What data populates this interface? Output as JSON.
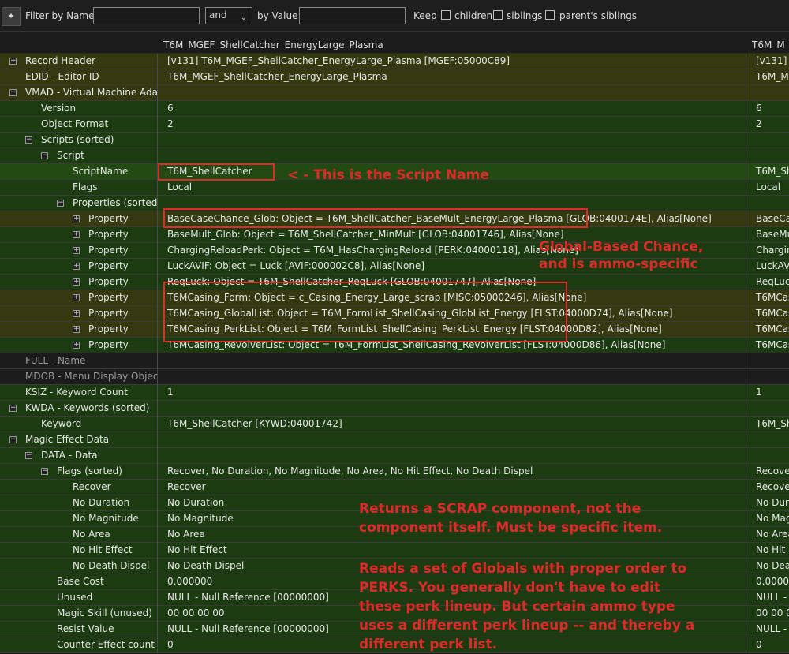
{
  "filter": {
    "pin_icon": "pin-icon",
    "name_label": "Filter by Name:",
    "name_value": "",
    "op_value": "and",
    "value_label": "by Value:",
    "value_value": "",
    "keep_label": "Keep",
    "checkboxes": [
      {
        "label": "children",
        "checked": false
      },
      {
        "label": "siblings",
        "checked": false
      },
      {
        "label": "parent's siblings",
        "checked": false
      }
    ]
  },
  "columns": {
    "col1": "T6M_MGEF_ShellCatcher_EnergyLarge_Plasma",
    "col2": "T6M_M"
  },
  "rows": [
    {
      "name": "Record Header",
      "level": 0,
      "expander": "+",
      "v1": "[v131] T6M_MGEF_ShellCatcher_EnergyLarge_Plasma [MGEF:05000C89]",
      "v2": "[v131] T",
      "bg": "bgO"
    },
    {
      "name": "EDID - Editor ID",
      "level": 0,
      "expander": "",
      "v1": "T6M_MGEF_ShellCatcher_EnergyLarge_Plasma",
      "v2": "T6M_MG",
      "bg": "bgO"
    },
    {
      "name": "VMAD - Virtual Machine Ada...",
      "level": 0,
      "expander": "-",
      "v1": "",
      "v2": "",
      "bg": "bgO"
    },
    {
      "name": "Version",
      "level": 1,
      "expander": "",
      "v1": "6",
      "v2": "6",
      "bg": "bgG"
    },
    {
      "name": "Object Format",
      "level": 1,
      "expander": "",
      "v1": "2",
      "v2": "2",
      "bg": "bgG"
    },
    {
      "name": "Scripts (sorted)",
      "level": 1,
      "expander": "-",
      "v1": "",
      "v2": "",
      "bg": "bgG"
    },
    {
      "name": "Script",
      "level": 2,
      "expander": "-",
      "v1": "",
      "v2": "",
      "bg": "bgG"
    },
    {
      "name": "ScriptName",
      "level": 3,
      "expander": "",
      "v1": "T6M_ShellCatcher",
      "v2": "T6M_Sh",
      "bg": "bgS"
    },
    {
      "name": "Flags",
      "level": 3,
      "expander": "",
      "v1": "Local",
      "v2": "Local",
      "bg": "bgG"
    },
    {
      "name": "Properties (sorted)",
      "level": 3,
      "expander": "-",
      "v1": "",
      "v2": "",
      "bg": "bgG"
    },
    {
      "name": "Property",
      "level": 4,
      "expander": "+",
      "v1": "BaseCaseChance_Glob: Object = T6M_ShellCatcher_BaseMult_EnergyLarge_Plasma [GLOB:0400174E], Alias[None]",
      "v2": "BaseCas",
      "bg": "bgO"
    },
    {
      "name": "Property",
      "level": 4,
      "expander": "+",
      "v1": "BaseMult_Glob: Object = T6M_ShellCatcher_MinMult [GLOB:04001746], Alias[None]",
      "v2": "BaseMu",
      "bg": "bgG"
    },
    {
      "name": "Property",
      "level": 4,
      "expander": "+",
      "v1": "ChargingReloadPerk: Object = T6M_HasChargingReload [PERK:04000118], Alias[None]",
      "v2": "Chargin",
      "bg": "bgG"
    },
    {
      "name": "Property",
      "level": 4,
      "expander": "+",
      "v1": "LuckAVIF: Object = Luck [AVIF:000002C8], Alias[None]",
      "v2": "LuckAVI",
      "bg": "bgG"
    },
    {
      "name": "Property",
      "level": 4,
      "expander": "+",
      "v1": "ReqLuck: Object = T6M_ShellCatcher_ReqLuck [GLOB:04001747], Alias[None]",
      "v2": "ReqLuck",
      "bg": "bgG"
    },
    {
      "name": "Property",
      "level": 4,
      "expander": "+",
      "v1": "T6MCasing_Form: Object = c_Casing_Energy_Large_scrap [MISC:05000246], Alias[None]",
      "v2": "T6MCas",
      "bg": "bgO"
    },
    {
      "name": "Property",
      "level": 4,
      "expander": "+",
      "v1": "T6MCasing_GlobalList: Object = T6M_FormList_ShellCasing_GlobList_Energy [FLST:04000D74], Alias[None]",
      "v2": "T6MCas",
      "bg": "bgO"
    },
    {
      "name": "Property",
      "level": 4,
      "expander": "+",
      "v1": "T6MCasing_PerkList: Object = T6M_FormList_ShellCasing_PerkList_Energy [FLST:04000D82], Alias[None]",
      "v2": "T6MCas",
      "bg": "bgO"
    },
    {
      "name": "Property",
      "level": 4,
      "expander": "+",
      "v1": "T6MCasing_RevolverList: Object = T6M_FormList_ShellCasing_RevolverList [FLST:04000D86], Alias[None]",
      "v2": "T6MCas",
      "bg": "bgG"
    },
    {
      "name": "FULL - Name",
      "level": 0,
      "expander": "",
      "v1": "",
      "v2": "",
      "bg": "bgD",
      "dim": true
    },
    {
      "name": "MDOB - Menu Display Object",
      "level": 0,
      "expander": "",
      "v1": "",
      "v2": "",
      "bg": "bgD",
      "dim": true
    },
    {
      "name": "KSIZ - Keyword Count",
      "level": 0,
      "expander": "",
      "v1": "1",
      "v2": "1",
      "bg": "bgG"
    },
    {
      "name": "KWDA - Keywords (sorted)",
      "level": 0,
      "expander": "-",
      "v1": "",
      "v2": "",
      "bg": "bgG"
    },
    {
      "name": "Keyword",
      "level": 1,
      "expander": "",
      "v1": "T6M_ShellCatcher [KYWD:04001742]",
      "v2": "T6M_Sh",
      "bg": "bgG"
    },
    {
      "name": "Magic Effect Data",
      "level": 0,
      "expander": "-",
      "v1": "",
      "v2": "",
      "bg": "bgG"
    },
    {
      "name": "DATA - Data",
      "level": 1,
      "expander": "-",
      "v1": "",
      "v2": "",
      "bg": "bgG"
    },
    {
      "name": "Flags (sorted)",
      "level": 2,
      "expander": "-",
      "v1": "Recover, No Duration, No Magnitude, No Area, No Hit Effect, No Death Dispel",
      "v2": "Recover",
      "bg": "bgG"
    },
    {
      "name": "Recover",
      "level": 3,
      "expander": "",
      "v1": "Recover",
      "v2": "Recover",
      "bg": "bgG"
    },
    {
      "name": "No Duration",
      "level": 3,
      "expander": "",
      "v1": "No Duration",
      "v2": "No Dura",
      "bg": "bgG"
    },
    {
      "name": "No Magnitude",
      "level": 3,
      "expander": "",
      "v1": "No Magnitude",
      "v2": "No Mag",
      "bg": "bgG"
    },
    {
      "name": "No Area",
      "level": 3,
      "expander": "",
      "v1": "No Area",
      "v2": "No Area",
      "bg": "bgG"
    },
    {
      "name": "No Hit Effect",
      "level": 3,
      "expander": "",
      "v1": "No Hit Effect",
      "v2": "No Hit E",
      "bg": "bgG"
    },
    {
      "name": "No Death Dispel",
      "level": 3,
      "expander": "",
      "v1": "No Death Dispel",
      "v2": "No Deat",
      "bg": "bgG"
    },
    {
      "name": "Base Cost",
      "level": 2,
      "expander": "",
      "v1": "0.000000",
      "v2": "0.00000",
      "bg": "bgG"
    },
    {
      "name": "Unused",
      "level": 2,
      "expander": "",
      "v1": "NULL - Null Reference [00000000]",
      "v2": "NULL - 0",
      "bg": "bgG"
    },
    {
      "name": "Magic Skill (unused)",
      "level": 2,
      "expander": "",
      "v1": "00 00 00 00",
      "v2": "00 00 00",
      "bg": "bgG"
    },
    {
      "name": "Resist Value",
      "level": 2,
      "expander": "",
      "v1": "NULL - Null Reference [00000000]",
      "v2": "NULL - 0",
      "bg": "bgG"
    },
    {
      "name": "Counter Effect count",
      "level": 2,
      "expander": "",
      "v1": "0",
      "v2": "0",
      "bg": "bgG"
    }
  ],
  "annotations": {
    "script_name": "< - This is the Script Name",
    "global_chance_1": "Global-Based Chance,",
    "global_chance_2": "and is ammo-specific",
    "scrap_1": "Returns a SCRAP component, not the",
    "scrap_2": "component itself. Must be specific item.",
    "perks_1": "Reads a set of Globals with proper order to",
    "perks_2": "PERKS. You generally don't have to edit",
    "perks_3": "these perk lineup. But certain ammo type",
    "perks_4": "uses a different perk lineup -- and thereby a",
    "perks_5": "different perk list."
  },
  "colors": {
    "annotation": "#dd2a2a",
    "row_green": "#1c3b10",
    "row_olive": "#343910"
  }
}
